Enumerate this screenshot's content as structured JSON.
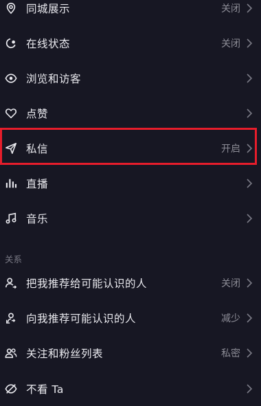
{
  "settings": {
    "items": [
      {
        "label": "同城展示",
        "value": "关闭",
        "icon": "location-pin-icon"
      },
      {
        "label": "在线状态",
        "value": "关闭",
        "icon": "online-status-icon"
      },
      {
        "label": "浏览和访客",
        "value": "",
        "icon": "eye-icon"
      },
      {
        "label": "点赞",
        "value": "",
        "icon": "heart-icon"
      },
      {
        "label": "私信",
        "value": "开启",
        "icon": "send-icon"
      },
      {
        "label": "直播",
        "value": "",
        "icon": "live-bars-icon"
      },
      {
        "label": "音乐",
        "value": "",
        "icon": "music-note-icon"
      }
    ]
  },
  "relations": {
    "section_label": "关系",
    "items": [
      {
        "label": "把我推荐给可能认识的人",
        "value": "关闭",
        "icon": "user-recommend-icon"
      },
      {
        "label": "向我推荐可能认识的人",
        "value": "减少",
        "icon": "user-suggest-icon"
      },
      {
        "label": "关注和粉丝列表",
        "value": "私密",
        "icon": "users-icon"
      },
      {
        "label": "不看 Ta",
        "value": "",
        "icon": "eye-off-icon"
      }
    ]
  },
  "highlight_color": "#e61d2b"
}
